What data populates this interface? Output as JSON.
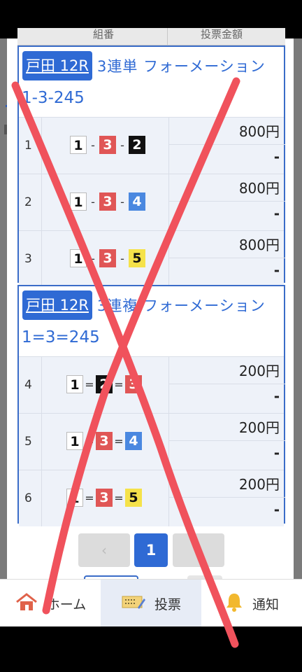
{
  "table_header": {
    "col_combo": "組番",
    "col_amount": "投票金額"
  },
  "bets": [
    {
      "race": "戸田 12R",
      "title": "3連単 フォーメーション",
      "combo": "1-3-245",
      "rows": [
        {
          "no": "1",
          "nums": [
            "1",
            "3",
            "2"
          ],
          "sep": "-",
          "price": "800円",
          "sub": "-"
        },
        {
          "no": "2",
          "nums": [
            "1",
            "3",
            "4"
          ],
          "sep": "-",
          "price": "800円",
          "sub": "-"
        },
        {
          "no": "3",
          "nums": [
            "1",
            "3",
            "5"
          ],
          "sep": "-",
          "price": "800円",
          "sub": "-"
        }
      ]
    },
    {
      "race": "戸田 12R",
      "title": "3連複 フォーメーション",
      "combo": "1=3=245",
      "rows": [
        {
          "no": "4",
          "nums": [
            "1",
            "2",
            "3"
          ],
          "sep": "=",
          "price": "200円",
          "sub": "-"
        },
        {
          "no": "5",
          "nums": [
            "1",
            "3",
            "4"
          ],
          "sep": "=",
          "price": "200円",
          "sub": "-"
        },
        {
          "no": "6",
          "nums": [
            "1",
            "3",
            "5"
          ],
          "sep": "=",
          "price": "200円",
          "sub": "-"
        }
      ]
    }
  ],
  "pagination": {
    "prev": "‹",
    "current": "1",
    "next": "›"
  },
  "tabs": {
    "home": "ホーム",
    "vote": "投票",
    "notice": "通知"
  },
  "colors": {
    "accent": "#2f6ad4",
    "overlay_x": "#f0525c"
  }
}
